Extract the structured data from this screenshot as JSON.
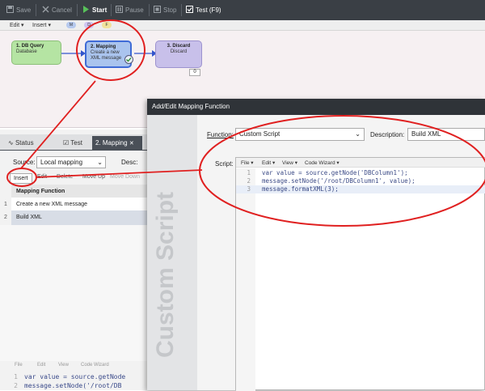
{
  "toolbar": {
    "save": "Save",
    "cancel": "Cancel",
    "start": "Start",
    "pause": "Pause",
    "stop": "Stop",
    "test": "Test (F9)"
  },
  "workflow": {
    "menu": {
      "edit": "Edit",
      "insert": "Insert"
    },
    "pills": [
      "M",
      "D",
      "F"
    ],
    "nodes": [
      {
        "title": "1. DB Query",
        "subtitle": "Database"
      },
      {
        "title": "2. Mapping",
        "subtitle": "Create a new XML message"
      },
      {
        "title": "3. Discard",
        "subtitle": "Discard",
        "badge": "0"
      }
    ]
  },
  "left_pane": {
    "tabs": [
      "Status",
      "Test",
      "2. Mapping"
    ],
    "source_label": "Source:",
    "source_value": "Local mapping",
    "desc_label": "Desc:",
    "actions": [
      "Insert",
      "Edit",
      "Delete",
      "Move Up",
      "Move Down"
    ],
    "column_header": "Mapping Function",
    "rows": [
      {
        "num": "1",
        "label": "Create a new XML message"
      },
      {
        "num": "2",
        "label": "Build XML"
      }
    ],
    "code_menu": [
      "File",
      "Edit",
      "View",
      "Code Wizard"
    ],
    "code": [
      {
        "num": "1",
        "text": "var value = source.getNode"
      },
      {
        "num": "2",
        "text": "message.setNode('/root/DB"
      }
    ]
  },
  "dialog": {
    "title": "Add/Edit Mapping Function",
    "watermark": "Custom Script",
    "function_label": "Function:",
    "function_value": "Custom Script",
    "description_label": "Description:",
    "description_value": "Build XML",
    "script_label": "Script:",
    "script_menu": [
      "File",
      "Edit",
      "View",
      "Code Wizard"
    ],
    "script_lines": [
      {
        "num": "1",
        "text": "var value = source.getNode('DBColumn1');"
      },
      {
        "num": "2",
        "text": "message.setNode('/root/DBColumn1', value);"
      },
      {
        "num": "3",
        "text": "message.formatXML(3);"
      }
    ]
  },
  "colors": {
    "toolbar_bg": "#3a3f45",
    "highlight_red": "#e02020",
    "node_green": "#b5e4a3",
    "node_blue": "#aac4ee",
    "node_purple": "#c8c0ea",
    "active_tab": "#4a5058"
  }
}
